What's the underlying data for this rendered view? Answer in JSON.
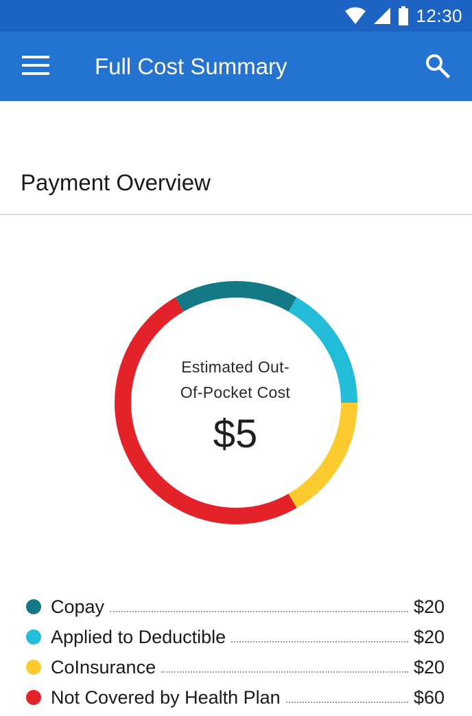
{
  "status_bar": {
    "time": "12:30",
    "icons": [
      "wifi-icon",
      "signal-icon",
      "battery-icon"
    ]
  },
  "app_bar": {
    "title": "Full Cost Summary",
    "menu_icon": "menu-icon",
    "search_icon": "search-icon",
    "color": "#2473d0"
  },
  "section": {
    "title": "Payment Overview"
  },
  "summary": {
    "label_line1": "Estimated Out-",
    "label_line2": "Of-Pocket Cost",
    "value": "$5"
  },
  "legend": [
    {
      "label": "Copay",
      "value": "$20",
      "color": "#137a85"
    },
    {
      "label": "Applied to Deductible",
      "value": "$20",
      "color": "#23bcd9"
    },
    {
      "label": "CoInsurance",
      "value": "$20",
      "color": "#fccb2f"
    },
    {
      "label": "Not Covered by Health Plan",
      "value": "$60",
      "color": "#e4222a"
    }
  ],
  "chart_data": {
    "type": "pie",
    "categories": [
      "Copay",
      "Applied to Deductible",
      "CoInsurance",
      "Not Covered by Health Plan"
    ],
    "values": [
      20,
      20,
      20,
      60
    ],
    "units": "$",
    "legend": "bottom"
  }
}
